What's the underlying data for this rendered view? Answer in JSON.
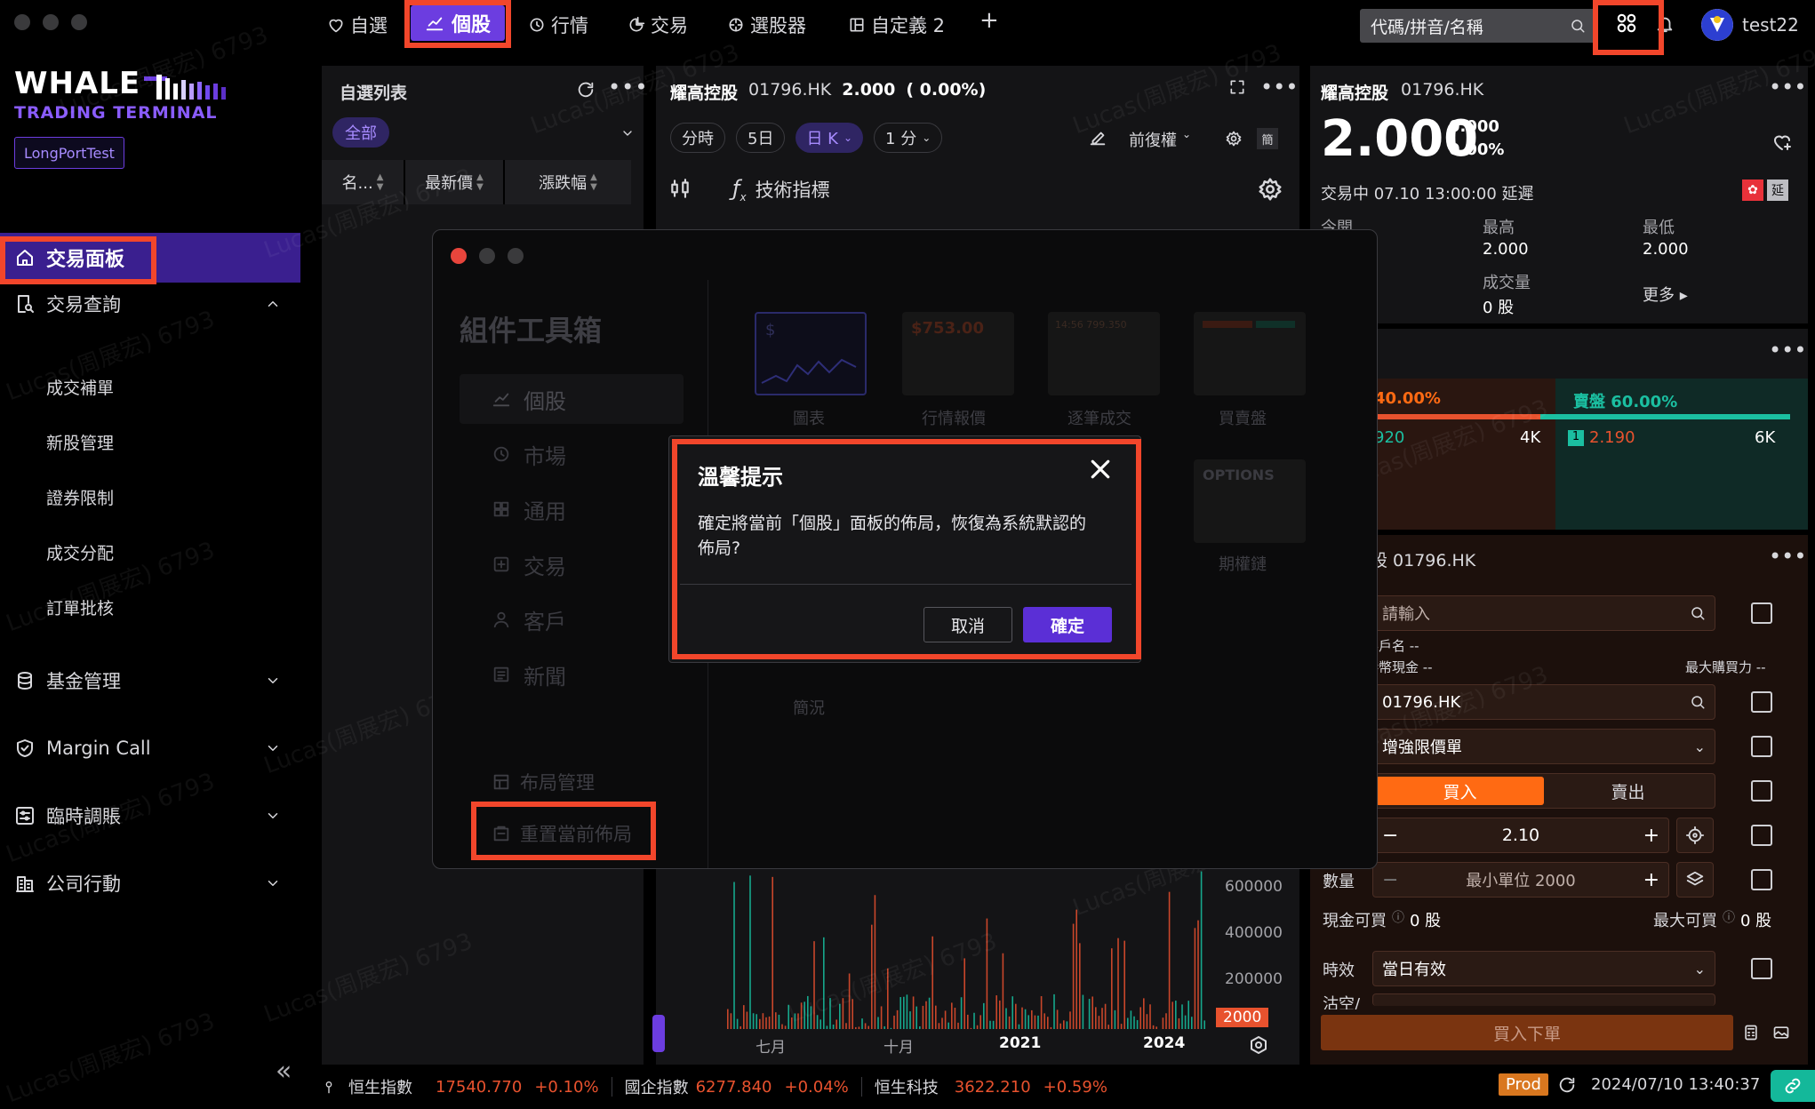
{
  "colors": {
    "accent": "#6c3de0",
    "highlight": "#f2462b",
    "up": "#e8522e",
    "down": "#1bbfa1",
    "orange": "#ff6a13",
    "bg": "#000000"
  },
  "top_nav": {
    "tabs": [
      {
        "label": "自選",
        "icon": "heart-icon"
      },
      {
        "label": "個股",
        "icon": "line-chart-icon"
      },
      {
        "label": "行情",
        "icon": "clock-icon"
      },
      {
        "label": "交易",
        "icon": "pie-icon"
      },
      {
        "label": "選股器",
        "icon": "target-icon"
      },
      {
        "label": "自定義 2",
        "icon": "layout-icon"
      },
      {
        "label": "+",
        "icon": "plus-icon"
      }
    ],
    "search_placeholder": "代碼/拼音/名稱",
    "username": "test22"
  },
  "sidebar": {
    "logo_line1": "WHALE",
    "logo_line2": "TRADING TERMINAL",
    "account_badge": "LongPortTest",
    "items": [
      {
        "label": "交易面板",
        "icon": "home-icon"
      },
      {
        "label": "交易查詢",
        "icon": "search-doc-icon"
      },
      {
        "label": "基金管理",
        "icon": "database-icon"
      },
      {
        "label": "Margin Call",
        "icon": "shield-icon"
      },
      {
        "label": "臨時調賬",
        "icon": "adjust-icon"
      },
      {
        "label": "公司行動",
        "icon": "building-icon"
      }
    ],
    "sub_items": [
      "成交補單",
      "新股管理",
      "證券限制",
      "成交分配",
      "訂單批核"
    ],
    "collapse_glyph": "«"
  },
  "watchlist": {
    "title": "自選列表",
    "filter": "全部",
    "columns": [
      "名...",
      "最新價",
      "漲跌幅"
    ]
  },
  "chart_panel": {
    "name": "耀高控股",
    "code": "01796.HK",
    "price": "2.000",
    "change": "( 0.00%)",
    "periods": [
      "分時",
      "5日",
      "日 K",
      "1 分"
    ],
    "adjust": "前復權",
    "simp": "簡",
    "indicators": "技術指標",
    "y_ticks": [
      "600000",
      "400000",
      "200000"
    ],
    "y_marker": "2000",
    "x_ticks": [
      "七月",
      "十月",
      "2021",
      "2024"
    ]
  },
  "quote_panel": {
    "name": "耀高控股",
    "code": "01796.HK",
    "price": "2.000",
    "change_abs": "0.000",
    "change_pct": "0.00%",
    "status": "交易中 07.10 13:00:00 延遲",
    "stats": [
      {
        "label": "今開",
        "value": ""
      },
      {
        "label": "最高",
        "value": "2.000"
      },
      {
        "label": "最低",
        "value": "2.000"
      },
      {
        "label": "",
        "value": ""
      },
      {
        "label": "成交量",
        "value": "0 股"
      },
      {
        "label": "更多 ▸",
        "value": ""
      }
    ]
  },
  "orderbook": {
    "bid_label": "40.00%",
    "ask_label": "賣盤 60.00%",
    "bid_price": "920",
    "bid_qty": "4K",
    "ask_level": "1",
    "ask_price": "2.190",
    "ask_qty": "6K",
    "bid_ratio": 0.4
  },
  "order_panel": {
    "title": "股 01796.HK",
    "account_placeholder": "請輸入",
    "client_name": "客戶名 --",
    "cash": "港幣現金 --",
    "max_buy_power": "最大購買力 --",
    "stock_code": "01796.HK",
    "order_type": "增強限價單",
    "buy": "買入",
    "sell": "賣出",
    "price_value": "2.10",
    "qty_label": "數量",
    "qty_placeholder": "最小單位 2000",
    "cash_buyable_label": "現金可買",
    "cash_buyable_value": "0 股",
    "max_buyable_label": "最大可買",
    "max_buyable_value": "0 股",
    "validity_label": "時效",
    "validity_value": "當日有效",
    "short_label": "沽空/",
    "submit": "買入下單"
  },
  "toolbox": {
    "title": "組件工具箱",
    "menu": [
      "個股",
      "市場",
      "通用",
      "交易",
      "客戶",
      "新聞"
    ],
    "menu_icons": [
      "line-chart-icon",
      "clock-icon",
      "grid-icon",
      "trade-icon",
      "user-icon",
      "news-icon"
    ],
    "layout_manage": "布局管理",
    "reset_layout": "重置當前佈局",
    "widgets": [
      {
        "label": "圖表",
        "preview": "$"
      },
      {
        "label": "行情報價",
        "preview": "$753.00"
      },
      {
        "label": "逐筆成交",
        "preview": "14:56  799.350"
      },
      {
        "label": "買賣盤",
        "preview": ""
      },
      {
        "label": "簡況",
        "preview": ""
      },
      {
        "label": "期權鏈",
        "preview": "OPTIONS"
      }
    ]
  },
  "dialog": {
    "title": "溫馨提示",
    "message": "確定將當前「個股」面板的佈局，恢復為系統默認的佈局?",
    "cancel": "取消",
    "confirm": "確定"
  },
  "status_bar": {
    "indices": [
      {
        "name": "恒生指數",
        "value": "17540.770",
        "change": "+0.10%"
      },
      {
        "name": "國企指數",
        "value": "6277.840",
        "change": "+0.04%"
      },
      {
        "name": "恒生科技",
        "value": "3622.210",
        "change": "+0.59%"
      }
    ],
    "env": "Prod",
    "datetime": "2024/07/10 13:40:37"
  },
  "watermark": "Lucas(周展宏) 6793"
}
